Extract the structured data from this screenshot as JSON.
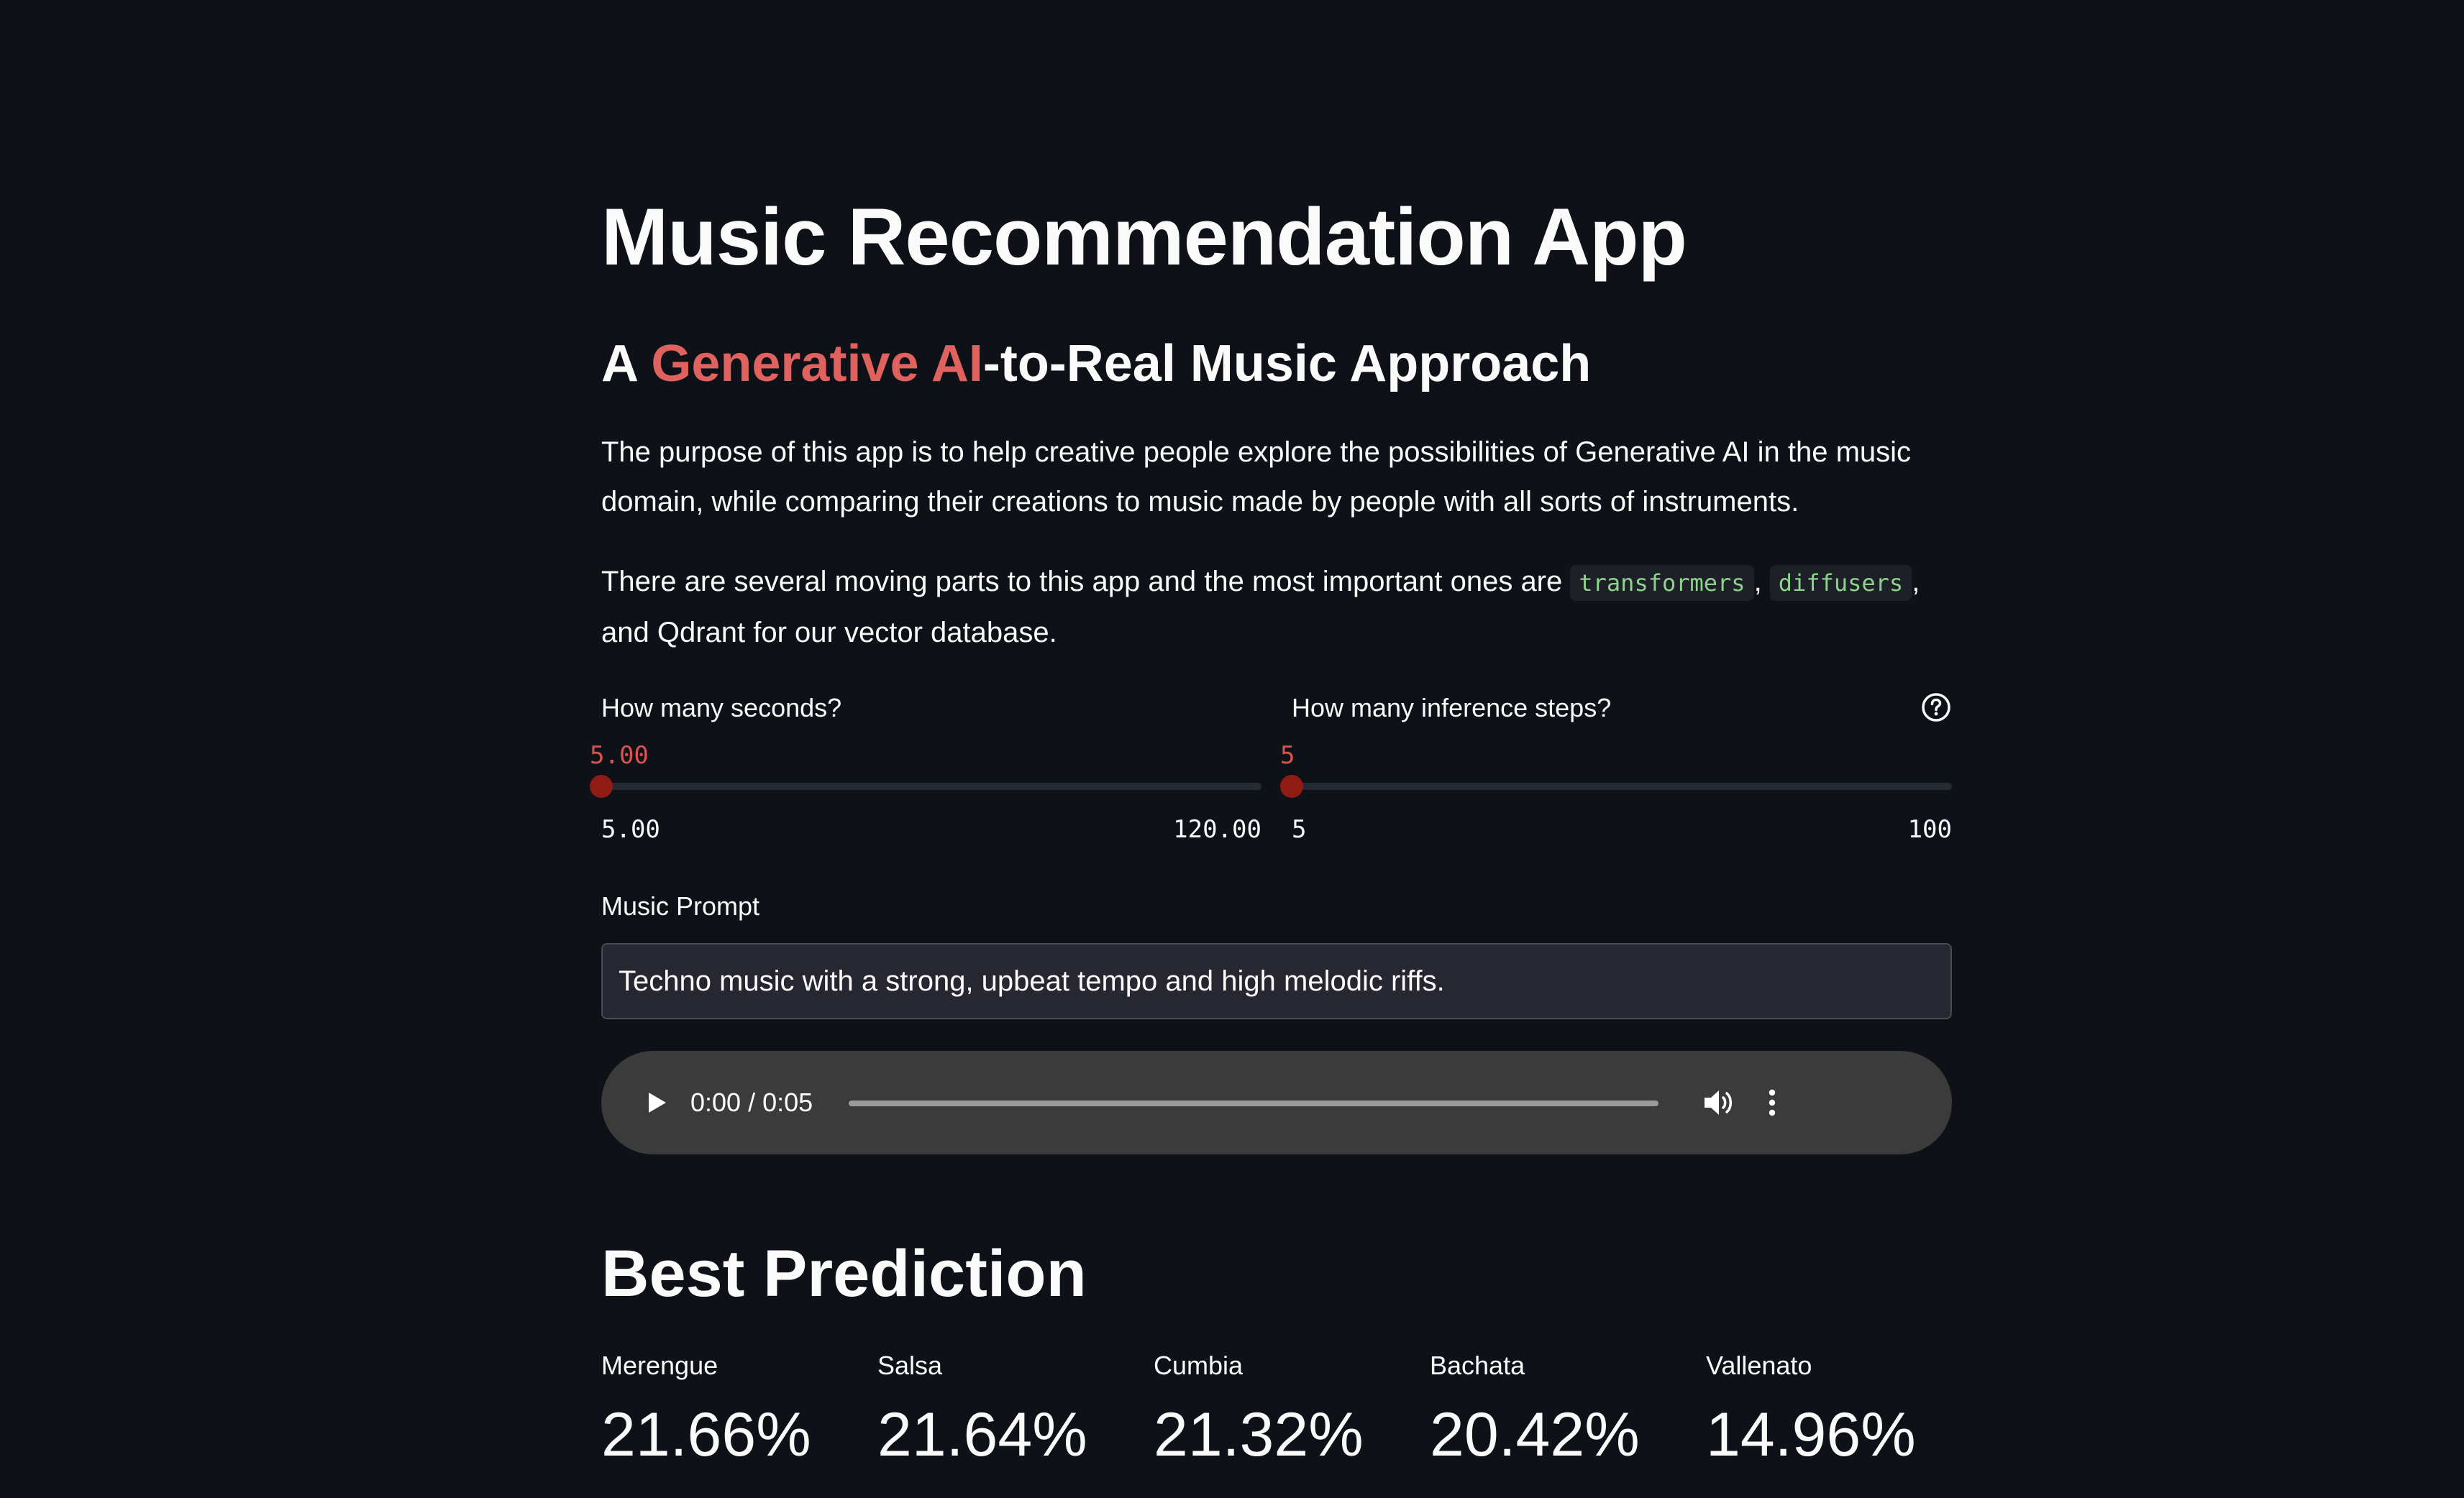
{
  "header": {
    "title": "Music Recommendation App",
    "subtitle_prefix": "A ",
    "subtitle_accent": "Generative AI",
    "subtitle_suffix": "-to-Real Music Approach"
  },
  "intro": {
    "paragraph1": "The purpose of this app is to help creative people explore the possibilities of Generative AI in the music domain, while comparing their creations to music made by people with all sorts of instruments.",
    "paragraph2_prefix": "There are several moving parts to this app and the most important ones are ",
    "code1": "transformers",
    "separator": ", ",
    "code2": "diffusers",
    "paragraph2_suffix": ", and Qdrant for our vector database."
  },
  "sliders": {
    "seconds": {
      "label": "How many seconds?",
      "value": "5.00",
      "min": "5.00",
      "max": "120.00",
      "fraction": 0.0
    },
    "steps": {
      "label": "How many inference steps?",
      "value": "5",
      "min": "5",
      "max": "100",
      "fraction": 0.0,
      "help_icon": "question-circle-icon"
    }
  },
  "prompt": {
    "label": "Music Prompt",
    "value": "Techno music with a strong, upbeat tempo and high melodic riffs."
  },
  "audio": {
    "time": "0:00 / 0:05",
    "progress_fraction": 0.0,
    "icons": [
      "play-icon",
      "volume-icon",
      "more-vertical-icon"
    ]
  },
  "prediction": {
    "title": "Best Prediction",
    "metrics": [
      {
        "label": "Merengue",
        "value": "21.66%"
      },
      {
        "label": "Salsa",
        "value": "21.64%"
      },
      {
        "label": "Cumbia",
        "value": "21.32%"
      },
      {
        "label": "Bachata",
        "value": "20.42%"
      },
      {
        "label": "Vallenato",
        "value": "14.96%"
      }
    ]
  },
  "colors": {
    "background": "#0e1117",
    "accent": "#e0625e",
    "slider_thumb": "#8f1b12",
    "code_text": "#8fd18f"
  }
}
